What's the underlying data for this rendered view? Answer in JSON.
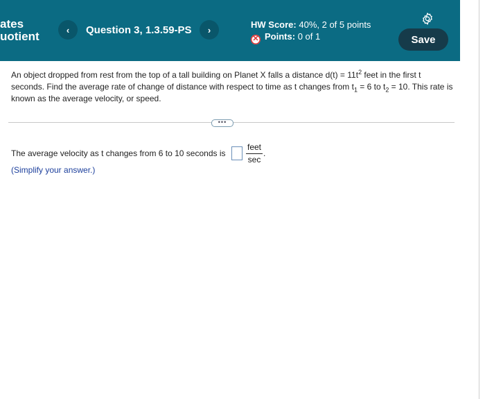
{
  "header": {
    "left_title_line1": "ates",
    "left_title_line2": "uotient",
    "prev_label": "‹",
    "question_title": "Question 3, 1.3.59-PS",
    "next_label": "›",
    "hw_score_label": "HW Score:",
    "hw_score_value": "40%, 2 of 5 points",
    "points_label": "Points:",
    "points_value": "0 of 1",
    "save_label": "Save",
    "icons": [
      "chevron-left-icon",
      "chevron-right-icon",
      "x-circle-icon",
      "gear-icon"
    ]
  },
  "problem": {
    "part1": "An object dropped from rest from the top of a tall building on Planet X falls a distance d(t) = 11t",
    "exp": "2",
    "part2": " feet in the first t seconds. Find the average rate of change of distance with respect to time as t changes from t",
    "sub1": "1",
    "part3": " = 6 to t",
    "sub2": "2",
    "part4": " = 10. This rate is known as the average velocity, or speed."
  },
  "expand_label": "•••",
  "answer": {
    "prompt": "The average velocity as t changes from 6 to 10 seconds is",
    "unit_numerator": "feet",
    "unit_denominator": "sec",
    "period": ".",
    "hint": "(Simplify your answer.)"
  },
  "colors": {
    "header_bg": "#0b6b83",
    "save_bg": "#163b4a",
    "hint_text": "#1c3f9c",
    "error": "#d33"
  }
}
